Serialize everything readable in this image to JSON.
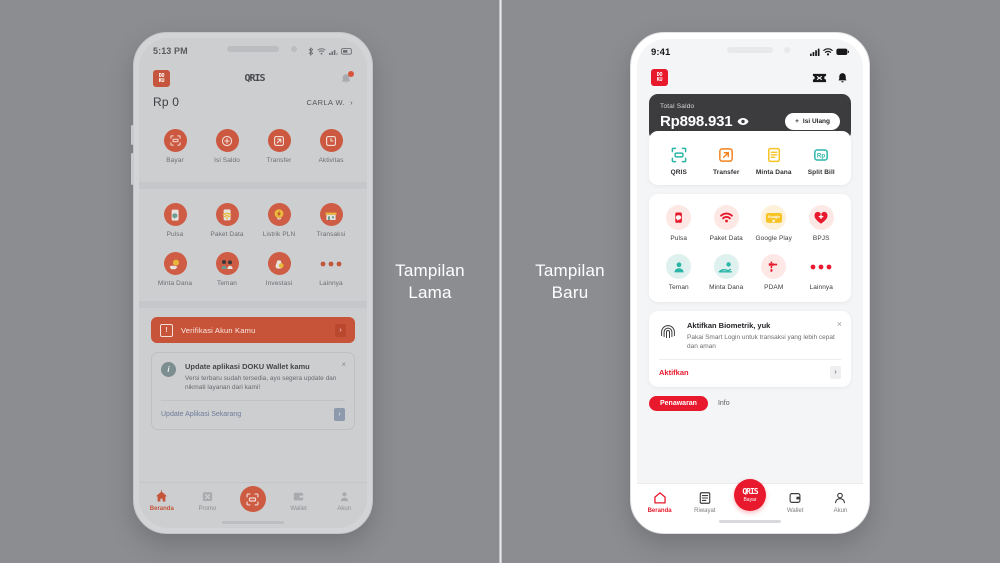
{
  "captions": {
    "left_line1": "Tampilan",
    "left_line2": "Lama",
    "right_line1": "Tampilan",
    "right_line2": "Baru"
  },
  "colors": {
    "background": "#8b8d91",
    "brand_red_new": "#e8192c",
    "brand_red_old": "#c75338",
    "dark_card": "#3c3c3e",
    "teal": "#2bb5a8",
    "orange": "#f5821f",
    "yellow": "#f7c325"
  },
  "old_phone": {
    "statusbar": {
      "time": "5:13 PM",
      "icons": [
        "bluetooth-icon",
        "wifi-icon",
        "signal-icon",
        "battery-icon"
      ]
    },
    "header": {
      "logo": "doku-logo",
      "qris_mark": "QRIS",
      "notification": "bell-icon"
    },
    "balance": {
      "amount": "Rp 0",
      "user": "CARLA W.",
      "chevron": "›"
    },
    "quick_actions": [
      {
        "label": "Bayar",
        "icon": "qr-scan-icon"
      },
      {
        "label": "Isi Saldo",
        "icon": "plus-circle-icon"
      },
      {
        "label": "Transfer",
        "icon": "arrow-up-right-icon"
      },
      {
        "label": "Aktivitas",
        "icon": "clock-icon"
      }
    ],
    "services": [
      {
        "label": "Pulsa",
        "icon": "phone-credit-icon"
      },
      {
        "label": "Paket Data",
        "icon": "wifi-data-icon"
      },
      {
        "label": "Listrik PLN",
        "icon": "bolt-icon"
      },
      {
        "label": "Transaksi",
        "icon": "store-icon"
      },
      {
        "label": "Minta Dana",
        "icon": "hand-coin-icon"
      },
      {
        "label": "Teman",
        "icon": "friends-icon"
      },
      {
        "label": "Investasi",
        "icon": "money-bag-icon"
      },
      {
        "label": "Lainnya",
        "icon": "ellipsis-icon"
      }
    ],
    "alert": {
      "icon": "exclamation-icon",
      "text": "Verifikasi Akun Kamu",
      "chevron": "›"
    },
    "update_card": {
      "icon": "info-icon",
      "title": "Update aplikasi DOKU Wallet kamu",
      "description": "Versi terbaru sudah tersedia, ayo segera update dan nikmati layanan dari kami!",
      "link": "Update Aplikasi Sekarang",
      "close": "×",
      "chevron": "›"
    },
    "nav": [
      {
        "label": "Beranda",
        "icon": "home-icon",
        "active": true
      },
      {
        "label": "Promo",
        "icon": "promo-icon",
        "active": false
      },
      {
        "label": "Bayar",
        "icon": "qr-scan-icon",
        "active": false
      },
      {
        "label": "Wallet",
        "icon": "wallet-icon",
        "active": false
      },
      {
        "label": "Akun",
        "icon": "user-icon",
        "active": false
      }
    ]
  },
  "new_phone": {
    "statusbar": {
      "time": "9:41",
      "icons": [
        "signal-icon",
        "wifi-icon",
        "battery-icon"
      ]
    },
    "header": {
      "logo": "doku-logo",
      "voucher": "voucher-icon",
      "notification": "bell-icon"
    },
    "balance": {
      "label": "Total Saldo",
      "amount": "Rp898.931",
      "eye": "eye-icon",
      "topup_plus": "+",
      "topup_label": "Isi Ulang"
    },
    "quick_actions": [
      {
        "label": "QRIS",
        "icon": "qr-scan-icon",
        "color": "#2bb5a8"
      },
      {
        "label": "Transfer",
        "icon": "arrow-up-right-icon",
        "color": "#f5821f"
      },
      {
        "label": "Minta Dana",
        "icon": "invoice-icon",
        "color": "#f7c325"
      },
      {
        "label": "Split Bill",
        "icon": "rp-split-icon",
        "color": "#2bb5a8"
      }
    ],
    "services": [
      {
        "label": "Pulsa",
        "icon": "phone-credit-icon"
      },
      {
        "label": "Paket Data",
        "icon": "wifi-data-icon"
      },
      {
        "label": "Google Play",
        "icon": "google-play-icon"
      },
      {
        "label": "BPJS",
        "icon": "heart-plus-icon"
      },
      {
        "label": "Teman",
        "icon": "friends-icon"
      },
      {
        "label": "Minta Dana",
        "icon": "hand-coin-icon"
      },
      {
        "label": "PDAM",
        "icon": "faucet-icon"
      },
      {
        "label": "Lainnya",
        "icon": "ellipsis-icon"
      }
    ],
    "biometric_card": {
      "icon": "fingerprint-icon",
      "title": "Aktifkan Biometrik, yuk",
      "description": "Pakai Smart Login untuk transaksi yang lebih cepat dan aman",
      "link": "Aktifkan",
      "close": "×",
      "chevron": "›"
    },
    "tabs": [
      {
        "label": "Penawaran",
        "active": true
      },
      {
        "label": "Info",
        "active": false
      }
    ],
    "nav": [
      {
        "label": "Beranda",
        "icon": "home-icon",
        "active": true
      },
      {
        "label": "Riwayat",
        "icon": "list-icon",
        "active": false
      },
      {
        "label": "Wallet",
        "icon": "wallet-icon",
        "active": false
      },
      {
        "label": "Akun",
        "icon": "user-icon",
        "active": false
      }
    ],
    "fab": {
      "qris": "QRIS",
      "label": "Bayar"
    }
  }
}
